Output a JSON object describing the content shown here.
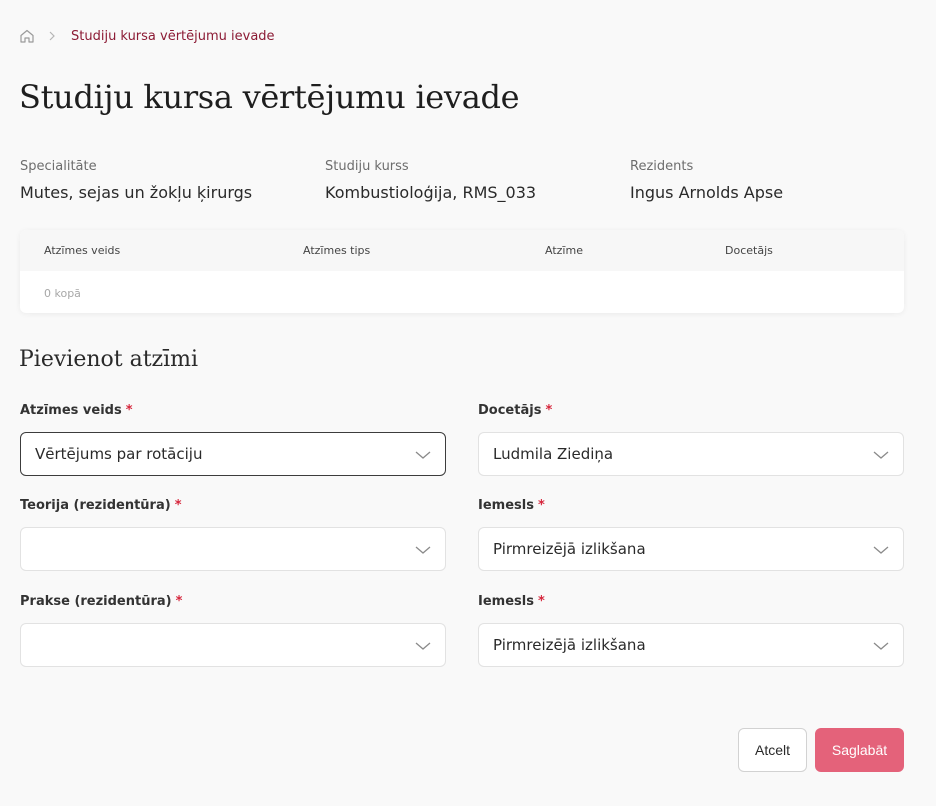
{
  "breadcrumb": {
    "home_icon": "home-icon",
    "separator_icon": "chevron-right-icon",
    "current": "Studiju kursa vērtējumu ievade"
  },
  "page_title": "Studiju kursa vērtējumu ievade",
  "info": {
    "specialty_label": "Specialitāte",
    "specialty_value": "Mutes, sejas un žokļu ķirurgs",
    "course_label": "Studiju kurss",
    "course_value": "Kombustioloģija, RMS_033",
    "resident_label": "Rezidents",
    "resident_value": "Ingus Arnolds Apse"
  },
  "grades_table": {
    "columns": [
      "Atzīmes veids",
      "Atzīmes tips",
      "Atzīme",
      "Docetājs"
    ],
    "count_text": "0 kopā"
  },
  "add_section": {
    "title": "Pievienot atzīmi",
    "required_mark": "*",
    "fields": [
      {
        "label": "Atzīmes veids",
        "value": "Vērtējums par rotāciju"
      },
      {
        "label": "Docetājs",
        "value": "Ludmila Ziediņa"
      },
      {
        "label": "Teorija (rezidentūra)",
        "value": ""
      },
      {
        "label": "Iemesls",
        "value": "Pirmreizējā izlikšana"
      },
      {
        "label": "Prakse (rezidentūra)",
        "value": ""
      },
      {
        "label": "Iemesls",
        "value": "Pirmreizējā izlikšana"
      }
    ]
  },
  "buttons": {
    "cancel": "Atcelt",
    "save": "Saglabāt"
  },
  "colors": {
    "accent": "#8c1b35",
    "save_button": "#e4627a",
    "required": "#d6263c"
  }
}
